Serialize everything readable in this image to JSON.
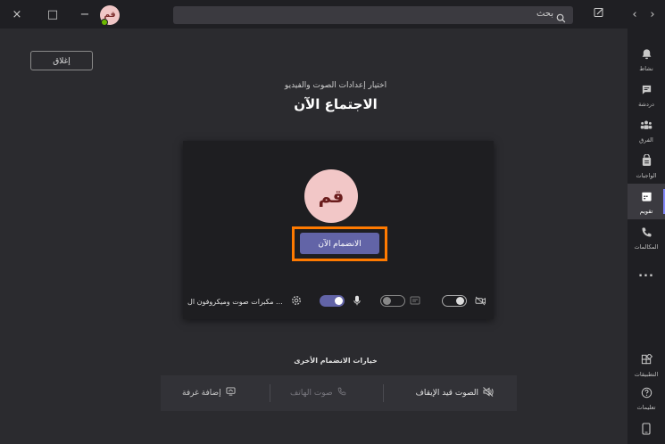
{
  "titlebar": {
    "close_glyph": "×",
    "maximize_glyph": "□",
    "minimize_glyph": "−",
    "avatar_initials": "قم",
    "search_text": "بحث"
  },
  "rail": {
    "items": [
      {
        "label": "نشاط",
        "icon": "bell-icon"
      },
      {
        "label": "دردشة",
        "icon": "chat-icon"
      },
      {
        "label": "الفرق",
        "icon": "teams-icon"
      },
      {
        "label": "الواجبات",
        "icon": "assignments-icon"
      },
      {
        "label": "تقويم",
        "icon": "calendar-icon"
      },
      {
        "label": "المكالمات",
        "icon": "phone-icon"
      },
      {
        "label": "...",
        "icon": "more-icon"
      },
      {
        "label": "التطبيقات",
        "icon": "apps-icon"
      },
      {
        "label": "تعليمات",
        "icon": "help-icon"
      }
    ],
    "active_index": 4
  },
  "main": {
    "close_label": "إغلاق",
    "subtitle": "اختيار إعدادات الصوت والفيديو",
    "title": "الاجتماع الآن",
    "avatar_initials": "قم",
    "join_label": "الانضمام الآن",
    "devices_label": "مكبرات صوت وميكروفون ال ...",
    "other_options_title": "خيارات الانضمام الأخرى",
    "options": {
      "audio_off": "الصوت قيد الإيقاف",
      "phone_audio": "صوت الهاتف",
      "add_room": "إضافة غرفة"
    }
  },
  "colors": {
    "accent": "#6264a7",
    "highlight": "#ff7a00",
    "background": "#2b2b2f",
    "rail": "#1f1f23"
  }
}
